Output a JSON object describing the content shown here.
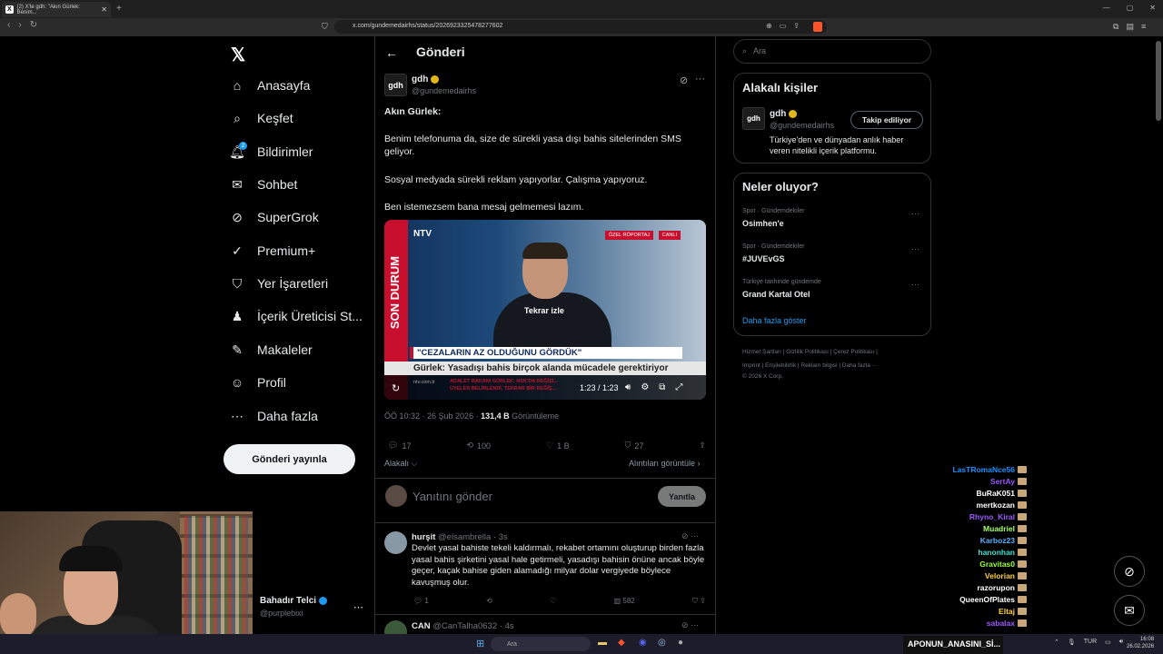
{
  "browser": {
    "tab_title": "(2) X'te gdh: \"Akın Gürlek: Benim...",
    "url": "x.com/gundemedairhs/status/2026923325478277602",
    "newtab": "+"
  },
  "sidebar": {
    "logo": "𝕏",
    "items": [
      {
        "label": "Anasayfa",
        "icon": "home-icon",
        "glyph": "⌂"
      },
      {
        "label": "Keşfet",
        "icon": "search-icon",
        "glyph": "⌕"
      },
      {
        "label": "Bildirimler",
        "icon": "bell-icon",
        "glyph": "🔔︎"
      },
      {
        "label": "Sohbet",
        "icon": "mail-icon",
        "glyph": "✉"
      },
      {
        "label": "SuperGrok",
        "icon": "grok-icon",
        "glyph": "⊘"
      },
      {
        "label": "Premium+",
        "icon": "premium-icon",
        "glyph": "✓"
      },
      {
        "label": "Yer İşaretleri",
        "icon": "bookmark-icon",
        "glyph": "⛉"
      },
      {
        "label": "İçerik Üreticisi St...",
        "icon": "creator-icon",
        "glyph": "♟"
      },
      {
        "label": "Makaleler",
        "icon": "article-icon",
        "glyph": "✎"
      },
      {
        "label": "Profil",
        "icon": "profile-icon",
        "glyph": "☺"
      },
      {
        "label": "Daha fazla",
        "icon": "more-icon",
        "glyph": "⋯"
      }
    ],
    "notif_count": "2",
    "post_button": "Gönderi yayınla",
    "user": {
      "name": "Bahadır Telci",
      "handle": "@purplebixi",
      "more": "⋯"
    }
  },
  "post": {
    "header": "Gönderi",
    "author_initials": "gdh",
    "author_name": "gdh",
    "author_handle": "@gundemedairhs",
    "lines": [
      "Akın Gürlek:",
      "Benim telefonuma da, size de sürekli yasa dışı bahis sitelerinden SMS geliyor.",
      "Sosyal medyada sürekli reklam yapıyorlar. Çalışma yapıyoruz.",
      "Ben istemezsem bana mesaj gelmemesi lazım."
    ],
    "video": {
      "channel": "NTV",
      "side_label": "SON DURUM",
      "tag1": "ÖZEL RÖPORTAJ",
      "tag2": "CANLI",
      "replay": "Tekrar izle",
      "headline": "\"CEZALARIN AZ OLDUĞUNU GÖRDÜK\"",
      "subline": "Gürlek: Yasadışı bahis birçok alanda mücadele gerektiriyor",
      "ticker_site": "ntv.com.tr",
      "ticker1": "ADALET BAKANI GÜRLEK: HSK'DA DEĞİŞİ...",
      "ticker2": "ÜYELER BELİRLENDİ, TEKRAR BİR DEĞİŞ...",
      "time": "1:23 / 1:23"
    },
    "meta_time": "ÖÖ 10:32 · 26 Şub 2026 · ",
    "meta_views": "131,4 B",
    "meta_views_label": " Görüntüleme",
    "stats": {
      "replies": "17",
      "reposts": "100",
      "likes": "1 B",
      "bookmarks": "27"
    },
    "relevant": "Alakalı ⌵",
    "quotes": "Alıntıları görüntüle ›",
    "reply_placeholder": "Yanıtını gönder",
    "reply_button": "Yanıtla"
  },
  "replies": [
    {
      "name": "hurşit",
      "handle": "@elsambrella · 3s",
      "text": "Devlet yasal bahiste tekeli kaldırmalı, rekabet ortamını oluşturup birden fazla yasal bahis şirketini yasal hale getirmeli, yasadışı bahisin önüne ancak böyle geçer, kaçak bahise giden alamadığı milyar dolar vergiyede böylece kavuşmuş olur.",
      "replies": "1",
      "views": "582"
    },
    {
      "name": "CAN",
      "handle": "@CanTalha0632 · 4s"
    }
  ],
  "right": {
    "search_placeholder": "Ara",
    "people_title": "Alakalı kişiler",
    "person": {
      "initials": "gdh",
      "name": "gdh",
      "handle": "@gundemedairhs",
      "follow": "Takip ediliyor",
      "bio": "Türkiye'den ve dünyadan anlık haber veren nitelikli içerik platformu."
    },
    "trends_title": "Neler oluyor?",
    "trends": [
      {
        "category": "Spor · Gündemdekiler",
        "name": "Osimhen'e"
      },
      {
        "category": "Spor · Gündemdekiler",
        "name": "#JUVEvGS"
      },
      {
        "category": "Türkiye tarihinde gündemde",
        "name": "Grand Kartal Otel"
      }
    ],
    "show_more": "Daha fazla göster",
    "footer1": "Hizmet Şartları  |  Gizlilik Politikası  |  Çerez Politikası  |",
    "footer2": "Imprint  |  Erişilebilirlik  |  Reklam bilgisi  |  Daha fazla ···",
    "footer3": "© 2026 X Corp."
  },
  "chat": [
    {
      "user": "LasTRomaNce56",
      "color": "#1e90ff"
    },
    {
      "user": "SertAy",
      "color": "#9b59ff"
    },
    {
      "user": "BuRaK051",
      "color": "#ffffff"
    },
    {
      "user": "mertkozan",
      "color": "#ffffff"
    },
    {
      "user": "Rhyno_Kiral",
      "color": "#9b59ff"
    },
    {
      "user": "Muadriel",
      "color": "#a4ff6b"
    },
    {
      "user": "Karboz23",
      "color": "#5ab0ff"
    },
    {
      "user": "hanonhan",
      "color": "#3fe0d0"
    },
    {
      "user": "Gravitas0",
      "color": "#9bff3b"
    },
    {
      "user": "Velorian",
      "color": "#ffd23b"
    },
    {
      "user": "razorupon",
      "color": "#ffffff"
    },
    {
      "user": "QueenOfPlates",
      "color": "#ffffff"
    },
    {
      "user": "Eltaj",
      "color": "#ffd23b"
    },
    {
      "user": "sabalax",
      "color": "#9b59ff"
    }
  ],
  "stream_banner": "APONUN_ANASINI_Sİ...",
  "taskbar": {
    "search": "Ara",
    "lang": "TUR",
    "time": "16:08",
    "date": "26.02.2026"
  }
}
